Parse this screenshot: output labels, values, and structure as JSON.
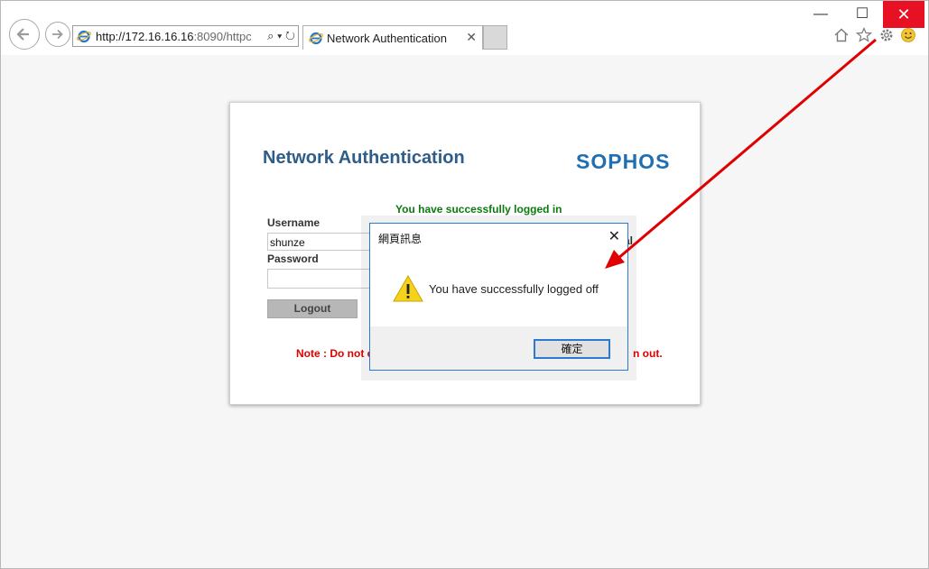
{
  "browser": {
    "url_main": "http://172.16.16.16",
    "url_dim": ":8090/httpc",
    "address_tools": "⌕ ▾ ↻",
    "tab_title": "Network Authentication",
    "tab_close": "✕",
    "min_label": "—",
    "max_label": "☐",
    "close_label": "✕"
  },
  "page": {
    "title": "Network Authentication",
    "logo": "SOPHOS",
    "success_message": "You have successfully logged in",
    "username_label": "Username",
    "username_value": "shunze",
    "password_label": "Password",
    "password_value": "",
    "logout_label": "Logout",
    "note_start": "Note : Do not c",
    "note_end": "n out.",
    "obscured_text": "al"
  },
  "dialog": {
    "title": "網頁訊息",
    "close": "✕",
    "message": "You have successfully logged off",
    "ok_label": "確定"
  },
  "colors": {
    "title": "#2f5d8a",
    "logo": "#1f6fb2",
    "success": "#0d7a10",
    "note": "#e00000",
    "close_button": "#e81123",
    "dialog_border": "#2b79d0",
    "arrow": "#e00000"
  }
}
